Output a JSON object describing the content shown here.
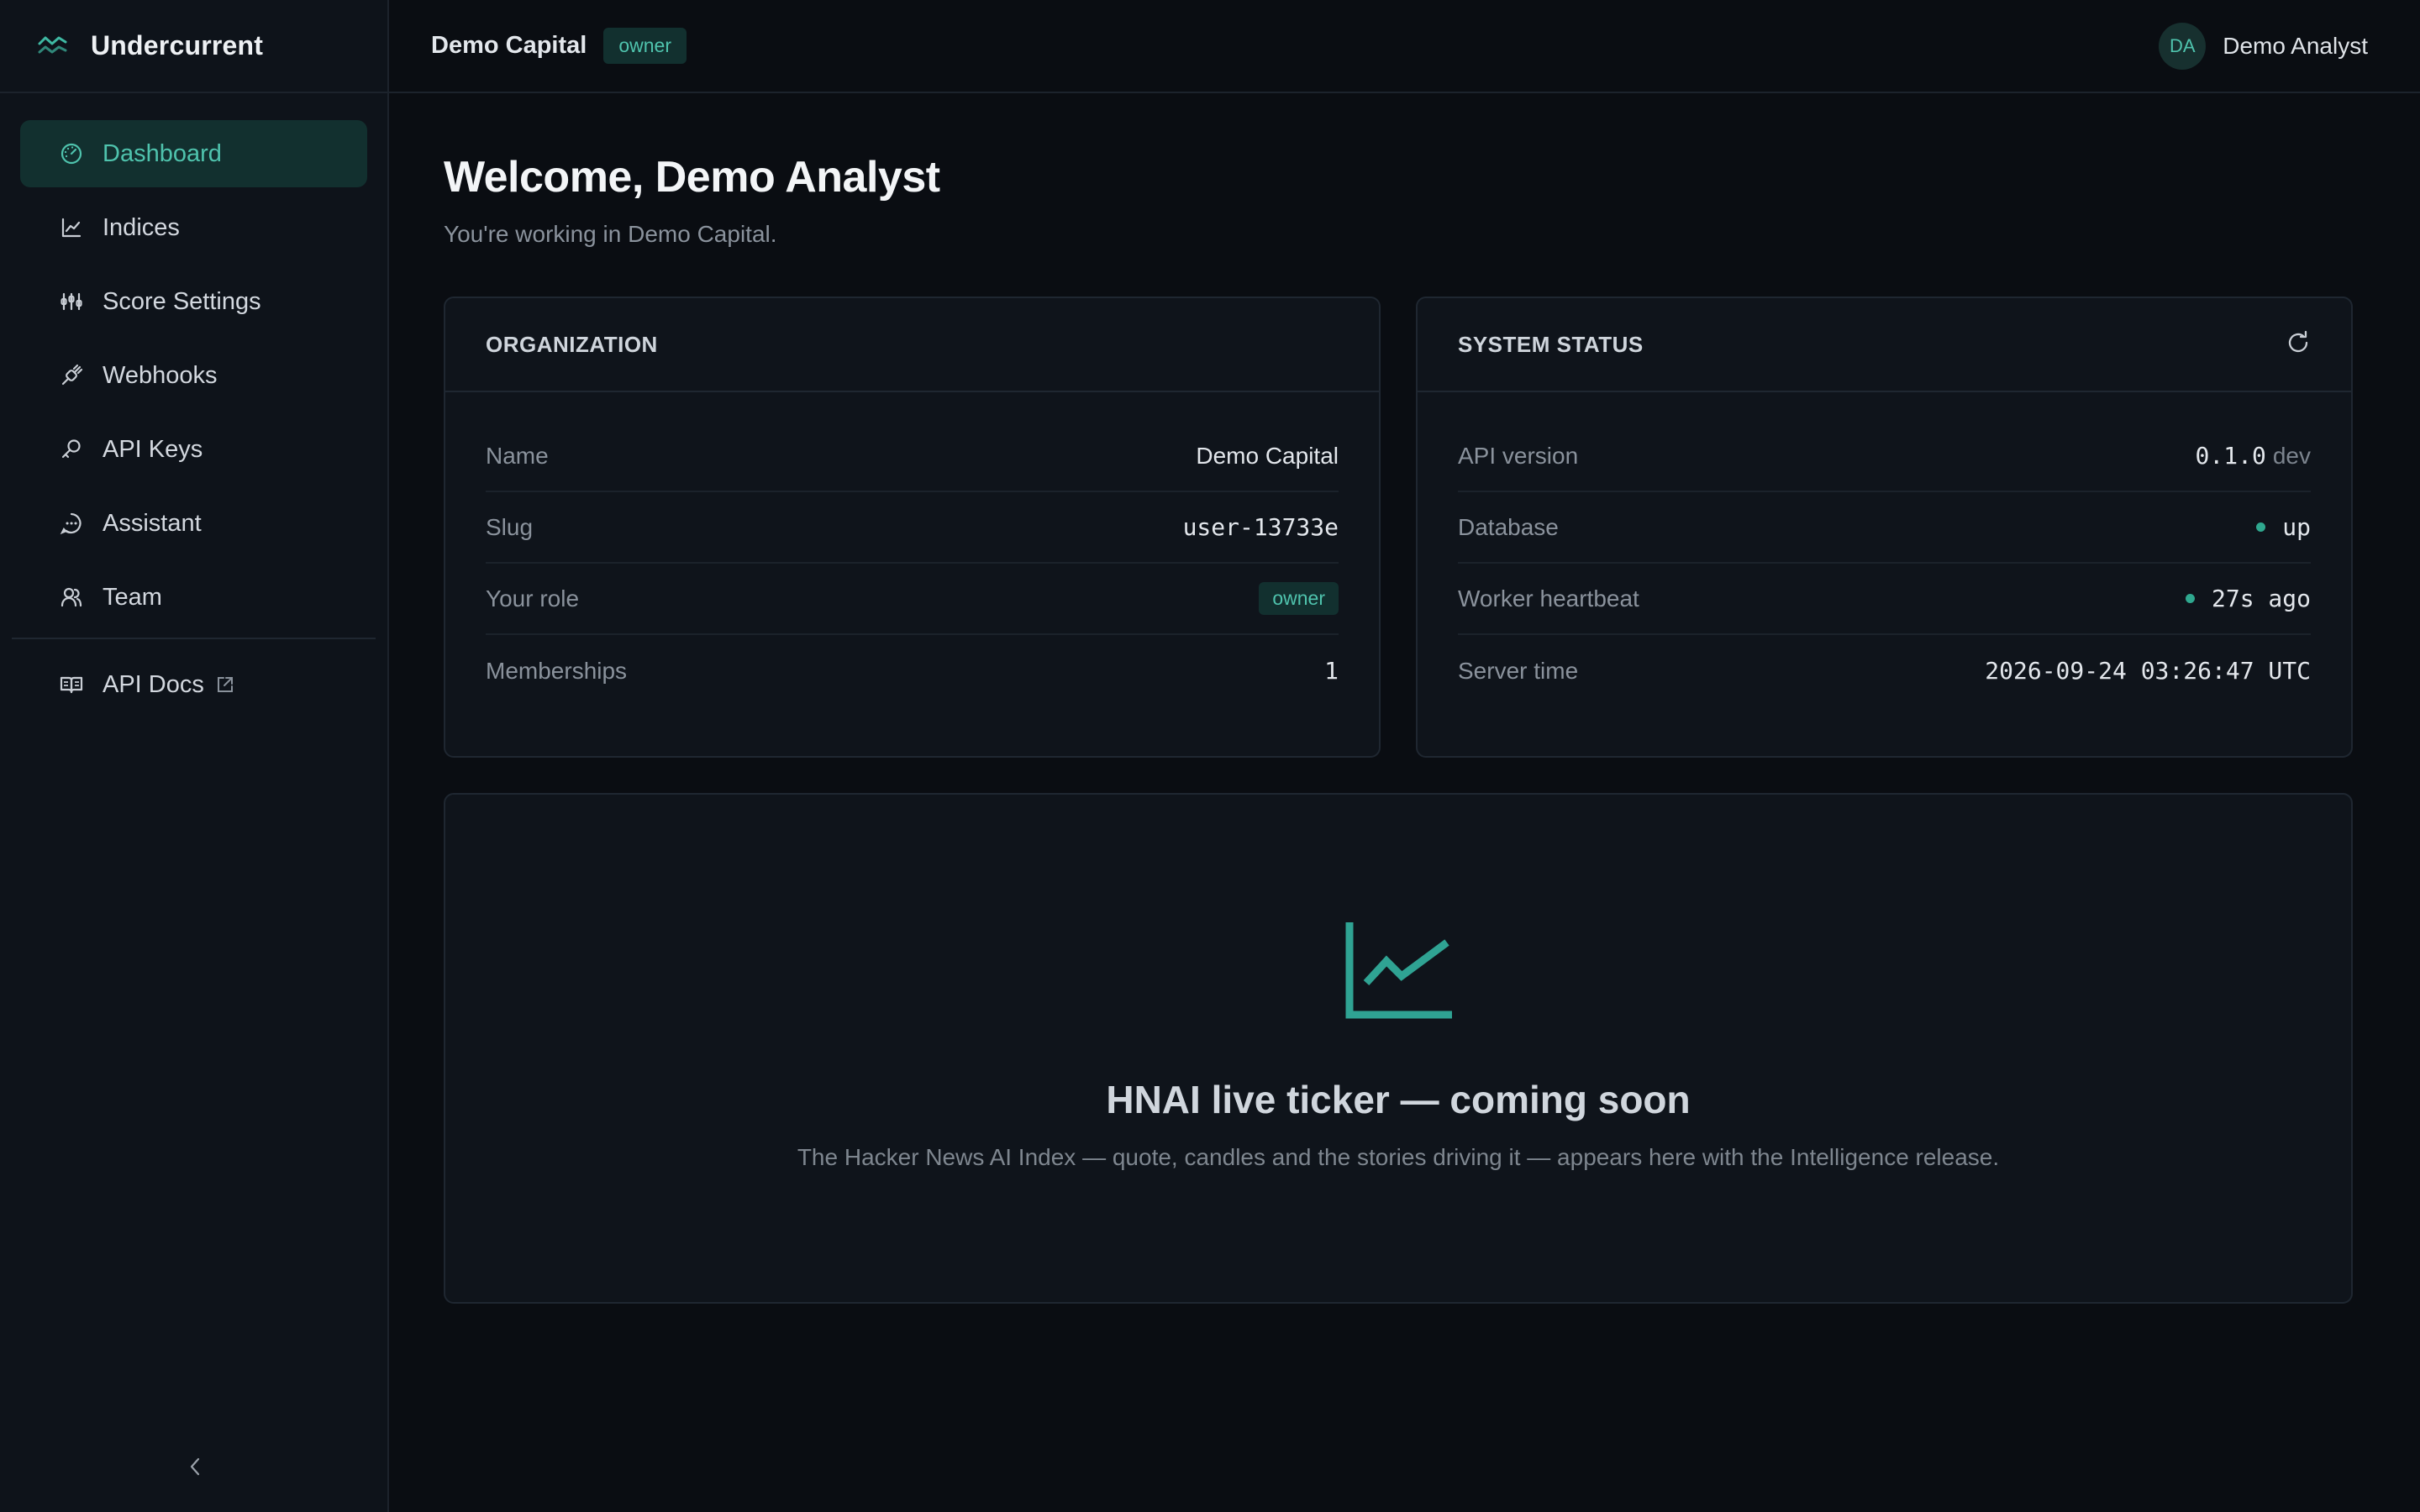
{
  "app": {
    "name": "Undercurrent"
  },
  "sidebar": {
    "items": [
      {
        "label": "Dashboard",
        "icon": "dashboard-gauge-icon",
        "active": true
      },
      {
        "label": "Indices",
        "icon": "line-chart-icon"
      },
      {
        "label": "Score Settings",
        "icon": "sliders-icon"
      },
      {
        "label": "Webhooks",
        "icon": "webhook-icon"
      },
      {
        "label": "API Keys",
        "icon": "key-icon"
      },
      {
        "label": "Assistant",
        "icon": "chat-bubble-icon"
      },
      {
        "label": "Team",
        "icon": "users-icon"
      }
    ],
    "docs": {
      "label": "API Docs",
      "icon": "book-icon"
    }
  },
  "topbar": {
    "org": "Demo Capital",
    "role_badge": "owner",
    "user": {
      "initials": "DA",
      "name": "Demo Analyst"
    }
  },
  "main": {
    "welcome": "Welcome, Demo Analyst",
    "subtitle": "You're working in Demo Capital."
  },
  "organization": {
    "title": "ORGANIZATION",
    "rows": [
      {
        "key": "Name",
        "value": "Demo Capital"
      },
      {
        "key": "Slug",
        "value": "user-13733e"
      },
      {
        "key": "Your role",
        "value": "owner"
      },
      {
        "key": "Memberships",
        "value": "1"
      }
    ]
  },
  "system_status": {
    "title": "SYSTEM STATUS",
    "api_version": {
      "key": "API version",
      "value": "0.1.0",
      "suffix": "dev"
    },
    "database": {
      "key": "Database",
      "value": "up"
    },
    "worker": {
      "key": "Worker heartbeat",
      "value": "27s ago"
    },
    "server_time": {
      "key": "Server time",
      "value": "2026-09-24 03:26:47 UTC"
    }
  },
  "ticker": {
    "title": "HNAI live ticker — coming soon",
    "description": "The Hacker News AI Index — quote, candles and the stories driving it — appears here with the Intelligence release."
  },
  "colors": {
    "accent": "#4fc3ad",
    "status_ok": "#2fa88f",
    "background": "#0a0d12"
  }
}
